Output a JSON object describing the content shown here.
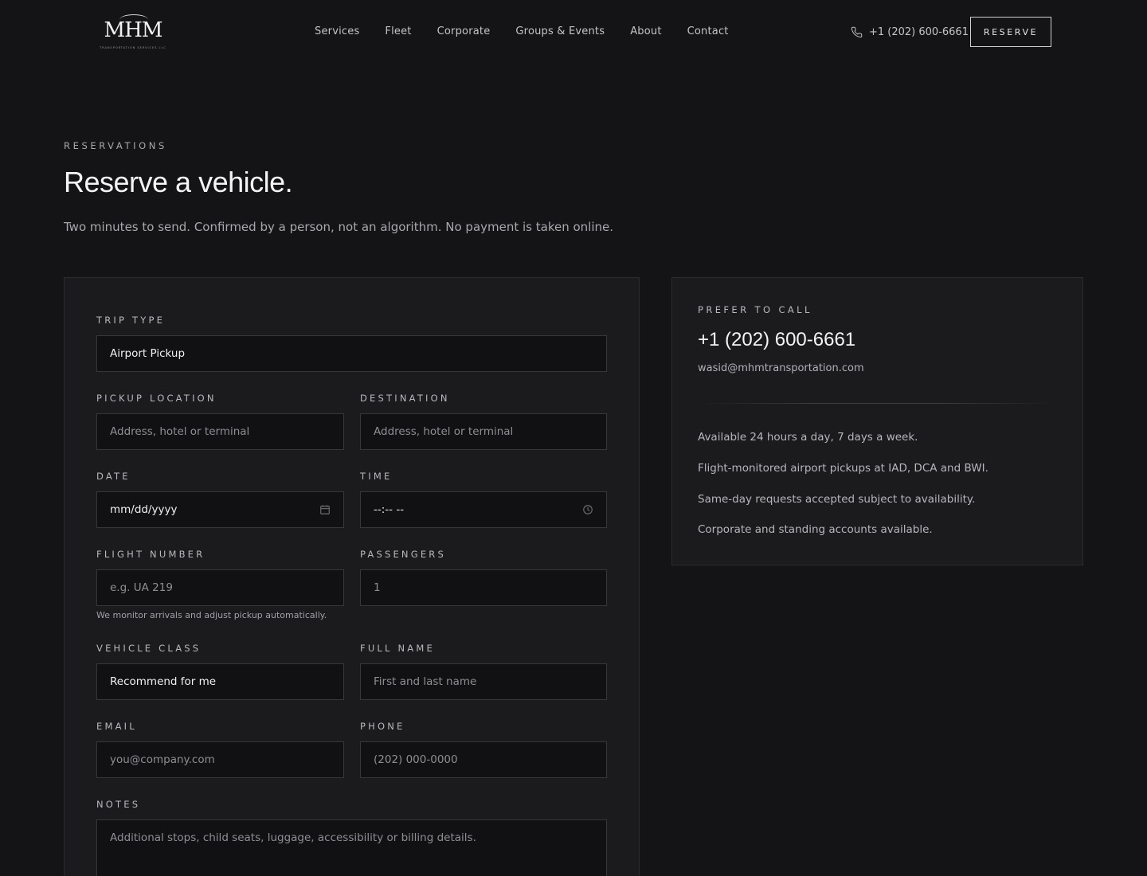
{
  "header": {
    "logo": {
      "mark": "MHM",
      "subtitle": "TRANSPORTATION SERVICES LLC"
    },
    "nav": [
      "Services",
      "Fleet",
      "Corporate",
      "Groups & Events",
      "About",
      "Contact"
    ],
    "phone": "+1 (202) 600-6661",
    "reserve_label": "RESERVE"
  },
  "hero": {
    "eyebrow": "RESERVATIONS",
    "title": "Reserve a vehicle.",
    "lede": "Two minutes to send. Confirmed by a person, not an algorithm. No payment is taken online."
  },
  "form": {
    "trip_type": {
      "label": "TRIP TYPE",
      "value": "Airport Pickup"
    },
    "pickup": {
      "label": "PICKUP LOCATION",
      "placeholder": "Address, hotel or terminal"
    },
    "destination": {
      "label": "DESTINATION",
      "placeholder": "Address, hotel or terminal"
    },
    "date": {
      "label": "DATE",
      "placeholder": "mm/dd/yyyy"
    },
    "time": {
      "label": "TIME",
      "placeholder": "--:-- --"
    },
    "flight": {
      "label": "FLIGHT NUMBER",
      "placeholder": "e.g. UA 219",
      "helper": "We monitor arrivals and adjust pickup automatically."
    },
    "passengers": {
      "label": "PASSENGERS",
      "placeholder": "1"
    },
    "vehicle_class": {
      "label": "VEHICLE CLASS",
      "value": "Recommend for me"
    },
    "full_name": {
      "label": "FULL NAME",
      "placeholder": "First and last name"
    },
    "email": {
      "label": "EMAIL",
      "placeholder": "you@company.com"
    },
    "phone": {
      "label": "PHONE",
      "placeholder": "(202) 000-0000"
    },
    "notes": {
      "label": "NOTES",
      "placeholder": "Additional stops, child seats, luggage, accessibility or billing details."
    }
  },
  "contact_card": {
    "eyebrow": "PREFER TO CALL",
    "phone": "+1 (202) 600-6661",
    "email": "wasid@mhmtransportation.com",
    "points": [
      "Available 24 hours a day, 7 days a week.",
      "Flight-monitored airport pickups at IAD, DCA and BWI.",
      "Same-day requests accepted subject to availability.",
      "Corporate and standing accounts available."
    ]
  },
  "colors": {
    "background": "#141416",
    "card": "#1b1b1e",
    "input": "#111113",
    "border": "#36363b"
  },
  "icons": [
    "phone-icon",
    "calendar-icon",
    "clock-icon"
  ]
}
